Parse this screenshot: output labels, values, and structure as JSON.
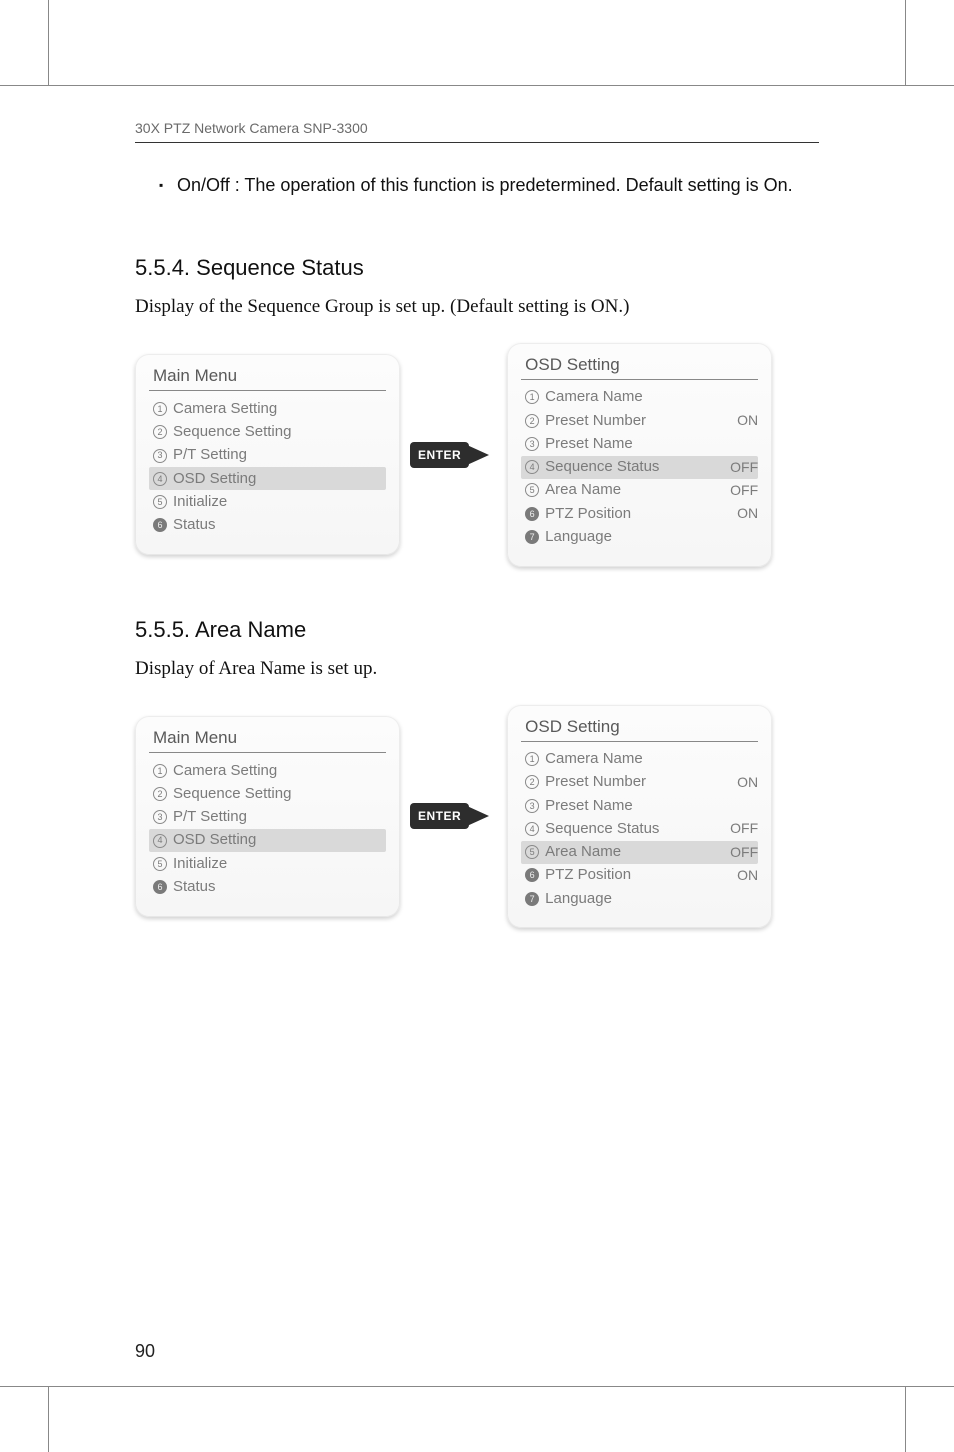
{
  "header": "30X PTZ Network Camera SNP-3300",
  "bullet_text": "On/Off : The operation of this function is predetermined. Default setting is On.",
  "section_554": {
    "heading": "5.5.4. Sequence Status",
    "desc": "Display of the Sequence Group is set up. (Default setting is ON.)"
  },
  "section_555": {
    "heading": "5.5.5. Area Name",
    "desc": "Display of Area Name is set up."
  },
  "enter_label": "ENTER",
  "main_menu": {
    "title": "Main Menu",
    "items": [
      {
        "n": "1",
        "label": "Camera Setting",
        "filled": false
      },
      {
        "n": "2",
        "label": "Sequence Setting",
        "filled": false
      },
      {
        "n": "3",
        "label": "P/T Setting",
        "filled": false
      },
      {
        "n": "4",
        "label": "OSD Setting",
        "filled": false,
        "hl": true
      },
      {
        "n": "5",
        "label": "Initialize",
        "filled": false
      },
      {
        "n": "6",
        "label": "Status",
        "filled": true
      }
    ]
  },
  "osd_seq": {
    "title": "OSD Setting",
    "items": [
      {
        "n": "1",
        "label": "Camera Name",
        "val": "",
        "filled": false
      },
      {
        "n": "2",
        "label": "Preset Number",
        "val": "ON",
        "filled": false
      },
      {
        "n": "3",
        "label": "Preset Name",
        "val": "",
        "filled": false
      },
      {
        "n": "4",
        "label": "Sequence Status",
        "val": "OFF",
        "filled": false,
        "hl": true
      },
      {
        "n": "5",
        "label": "Area Name",
        "val": "OFF",
        "filled": false
      },
      {
        "n": "6",
        "label": "PTZ Position",
        "val": "ON",
        "filled": true
      },
      {
        "n": "7",
        "label": "Language",
        "val": "",
        "filled": true
      }
    ]
  },
  "osd_area": {
    "title": "OSD Setting",
    "items": [
      {
        "n": "1",
        "label": "Camera Name",
        "val": "",
        "filled": false
      },
      {
        "n": "2",
        "label": "Preset Number",
        "val": "ON",
        "filled": false
      },
      {
        "n": "3",
        "label": "Preset Name",
        "val": "",
        "filled": false
      },
      {
        "n": "4",
        "label": "Sequence Status",
        "val": "OFF",
        "filled": false
      },
      {
        "n": "5",
        "label": "Area Name",
        "val": "OFF",
        "filled": false,
        "hl": true
      },
      {
        "n": "6",
        "label": "PTZ Position",
        "val": "ON",
        "filled": true
      },
      {
        "n": "7",
        "label": "Language",
        "val": "",
        "filled": true
      }
    ]
  },
  "page_number": "90"
}
